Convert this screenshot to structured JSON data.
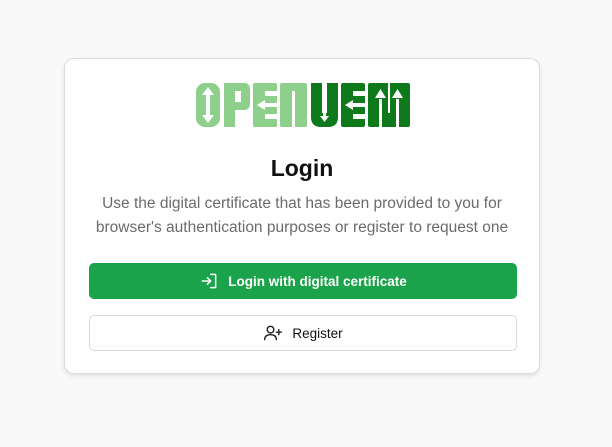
{
  "logo": {
    "text_light": "OPEN",
    "text_dark": "UEM",
    "color_light": "#8fcf8c",
    "color_dark": "#0f7a1c"
  },
  "login": {
    "title": "Login",
    "description": "Use the digital certificate that has been provided to you for browser's authentication purposes or register to request one",
    "certificate_button": {
      "label": "Login with digital certificate",
      "icon": "login-arrow-icon"
    },
    "register_button": {
      "label": "Register",
      "icon": "user-plus-icon"
    }
  },
  "colors": {
    "primary": "#1aa34a",
    "background": "#f9f9f9"
  }
}
